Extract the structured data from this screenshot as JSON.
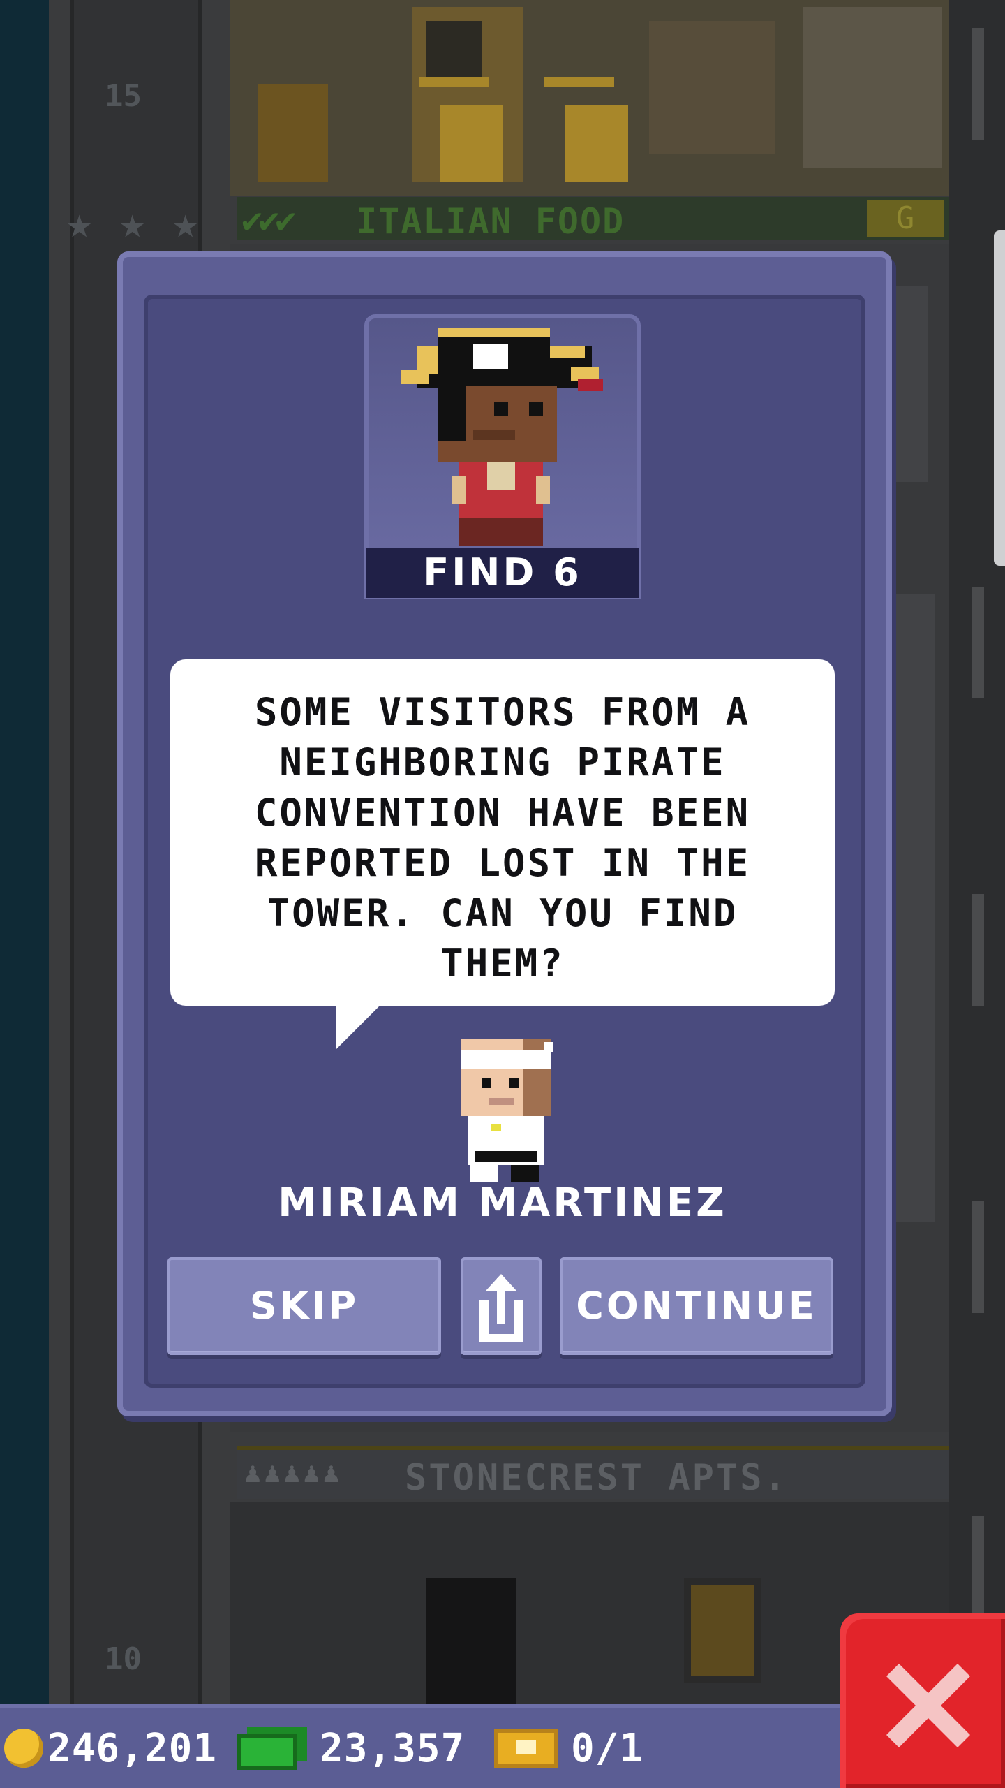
{
  "background": {
    "floors": [
      {
        "number": "15",
        "name": "ITALIAN FOOD",
        "stars_filled": 0,
        "stars_total": 3,
        "checks": 3,
        "badge": "G"
      },
      {
        "name": "STONECREST APTS.",
        "number": "10"
      }
    ]
  },
  "dialog": {
    "portrait_caption": "FIND 6",
    "message": "SOME VISITORS FROM A NEIGHBORING PIRATE CONVENTION HAVE BEEN REPORTED LOST IN THE TOWER. CAN YOU FIND THEM?",
    "speaker_name": "MIRIAM MARTINEZ",
    "buttons": {
      "skip": "SKIP",
      "continue": "CONTINUE"
    }
  },
  "hud": {
    "coins": "246,201",
    "bux": "23,357",
    "tickets": "0/1"
  },
  "colors": {
    "dialog_bg": "#5d5e94",
    "dialog_inner": "#4a4b7e",
    "button": "#8284b8",
    "close_button": "#e2242a",
    "coin": "#f2c131",
    "bux": "#2ab337",
    "ticket": "#e8ae22"
  },
  "icons": [
    "coin-icon",
    "bux-icon",
    "ticket-icon",
    "share-icon",
    "close-icon",
    "star-icon",
    "check-icon"
  ]
}
